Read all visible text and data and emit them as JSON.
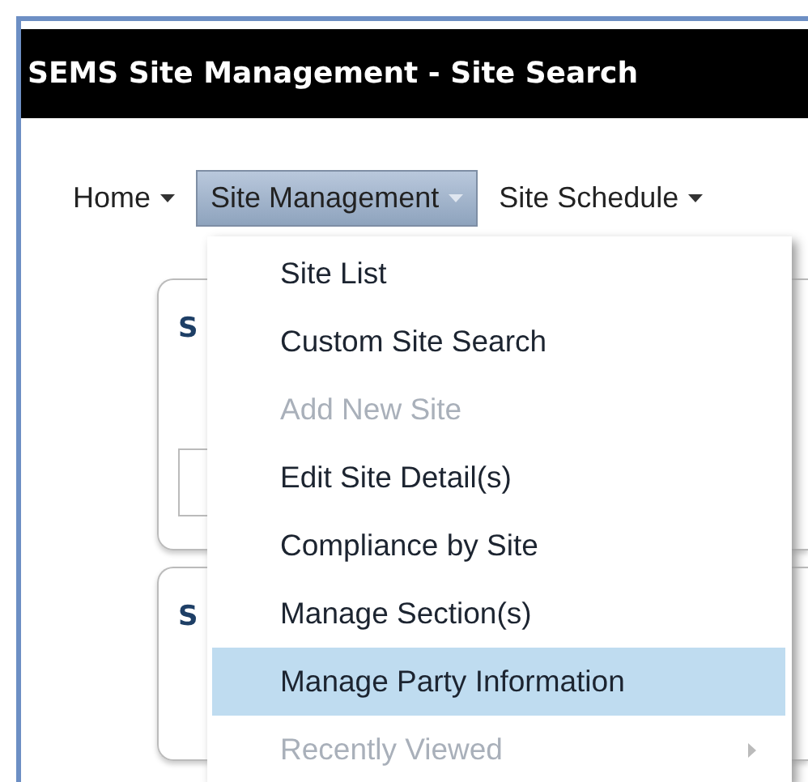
{
  "window": {
    "title": "SEMS Site Management - Site Search"
  },
  "nav": [
    {
      "label": "Home",
      "selected": false
    },
    {
      "label": "Site Management",
      "selected": true
    },
    {
      "label": "Site Schedule",
      "selected": false
    }
  ],
  "panels": [
    {
      "heading": "S"
    },
    {
      "heading": "S"
    }
  ],
  "menu": [
    {
      "label": "Site List",
      "disabled": false,
      "highlighted": false,
      "submenu": false
    },
    {
      "label": "Custom Site Search",
      "disabled": false,
      "highlighted": false,
      "submenu": false
    },
    {
      "label": "Add New Site",
      "disabled": true,
      "highlighted": false,
      "submenu": false
    },
    {
      "label": "Edit Site Detail(s)",
      "disabled": false,
      "highlighted": false,
      "submenu": false
    },
    {
      "label": "Compliance by Site",
      "disabled": false,
      "highlighted": false,
      "submenu": false
    },
    {
      "label": "Manage Section(s)",
      "disabled": false,
      "highlighted": false,
      "submenu": false
    },
    {
      "label": "Manage Party Information",
      "disabled": false,
      "highlighted": true,
      "submenu": false
    },
    {
      "label": "Recently Viewed",
      "disabled": true,
      "highlighted": false,
      "submenu": true
    }
  ]
}
